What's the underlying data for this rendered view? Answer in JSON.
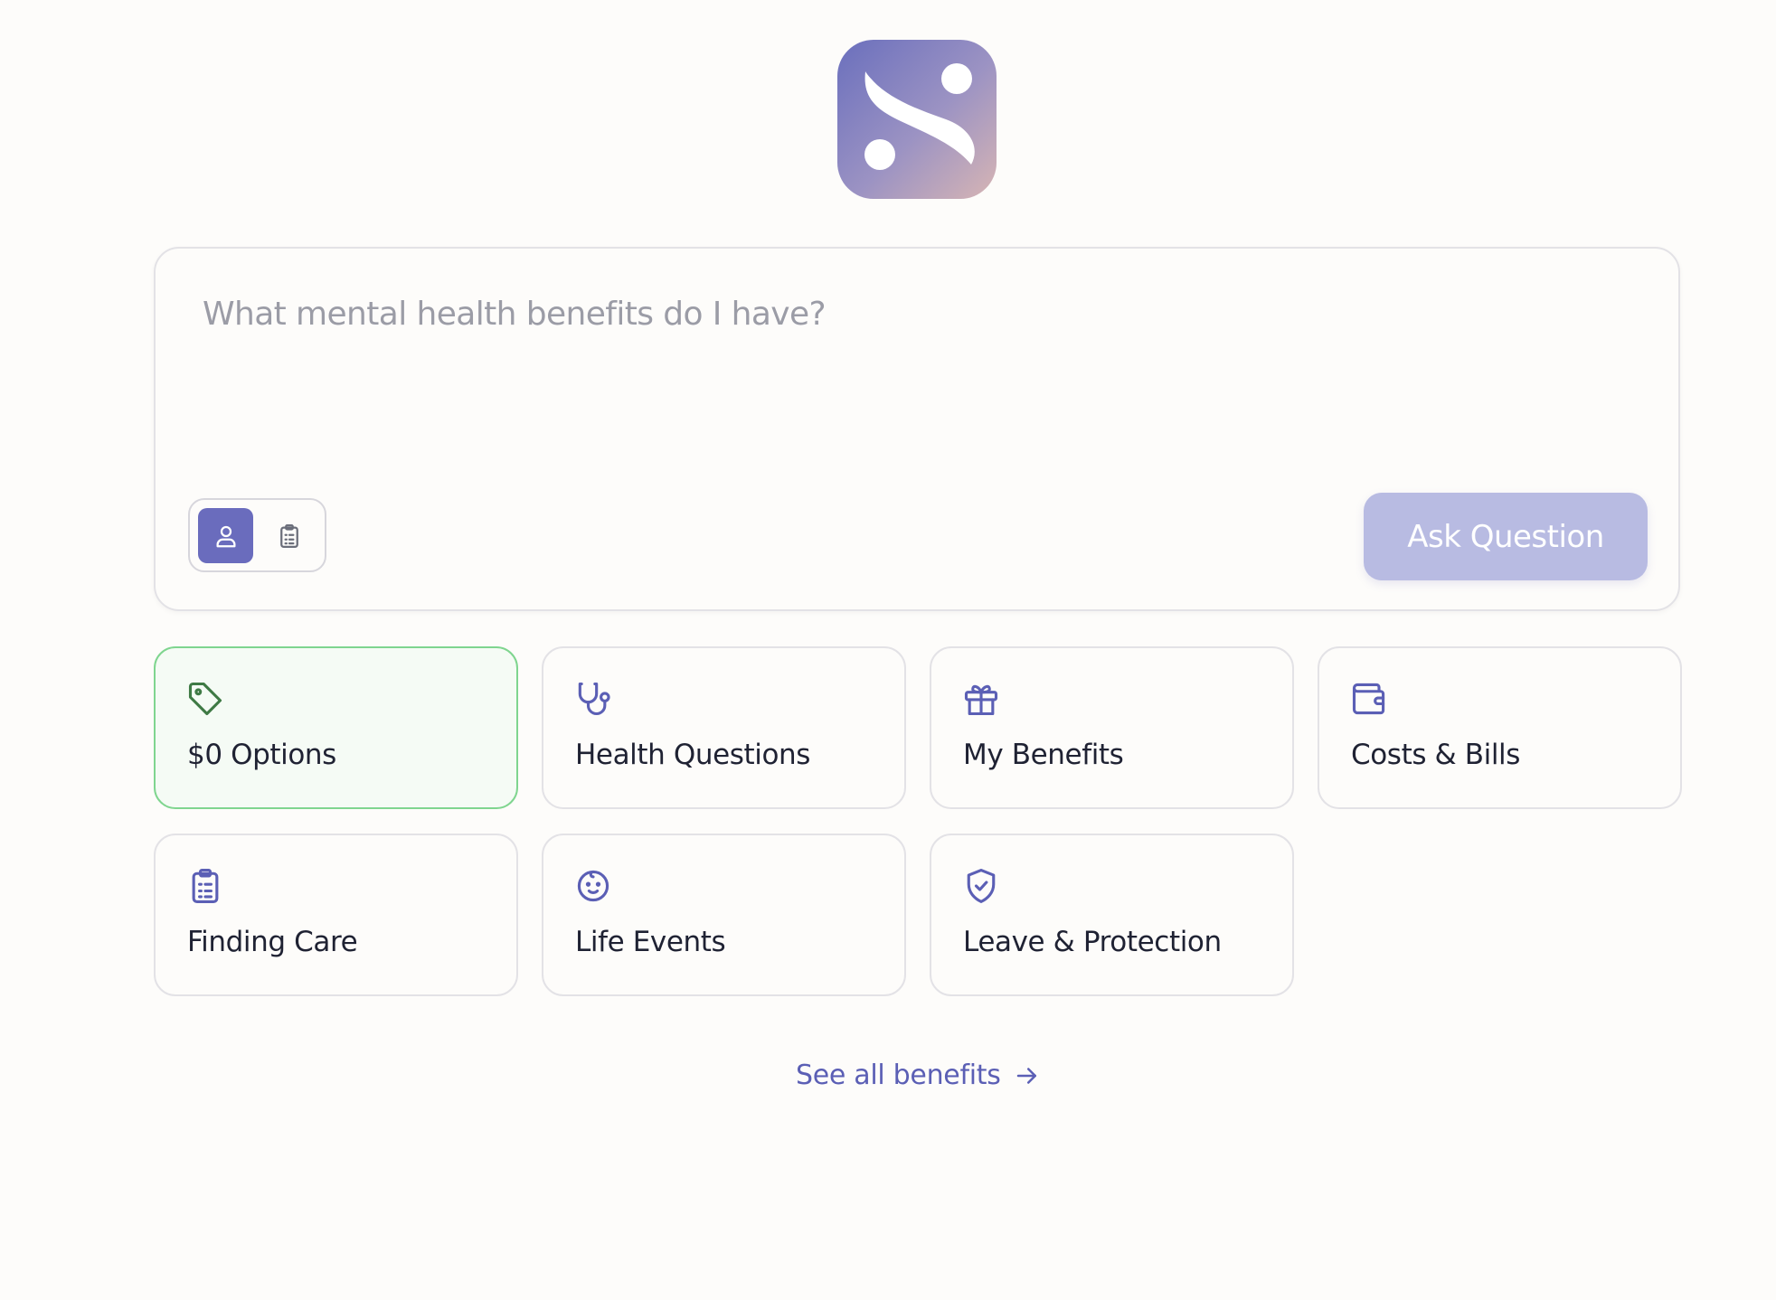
{
  "colors": {
    "accent": "#6a6cbd",
    "accent_light": "#b8bbe2",
    "link": "#5b5fb5",
    "active_tile_bg": "#f5fbf5",
    "active_tile_border": "#7fd58f",
    "active_icon": "#3f7a45",
    "background": "#fdfcfa"
  },
  "logo": {
    "icon": "brand-s-logo"
  },
  "ask": {
    "placeholder": "What mental health benefits do I have?",
    "value": "",
    "modes": [
      {
        "icon": "person-icon",
        "selected": true
      },
      {
        "icon": "clipboard-list-icon",
        "selected": false
      }
    ],
    "button_label": "Ask Question"
  },
  "categories": [
    {
      "label": "$0 Options",
      "icon": "tag-icon",
      "active": true
    },
    {
      "label": "Health Questions",
      "icon": "stethoscope-icon",
      "active": false
    },
    {
      "label": "My Benefits",
      "icon": "gift-icon",
      "active": false
    },
    {
      "label": "Costs & Bills",
      "icon": "wallet-icon",
      "active": false
    },
    {
      "label": "Finding Care",
      "icon": "clipboard-list-icon",
      "active": false
    },
    {
      "label": "Life Events",
      "icon": "baby-icon",
      "active": false
    },
    {
      "label": "Leave & Protection",
      "icon": "shield-check-icon",
      "active": false
    }
  ],
  "see_all": {
    "label": "See all benefits",
    "icon": "arrow-right-icon"
  }
}
